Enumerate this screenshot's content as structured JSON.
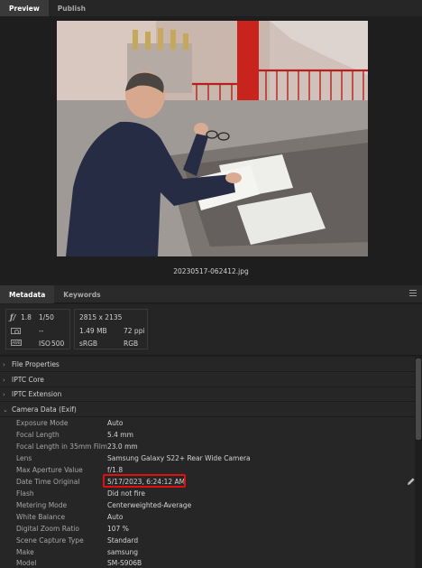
{
  "top_tabs": [
    "Preview",
    "Publish"
  ],
  "filename": "20230517-062412.jpg",
  "meta_tabs": [
    "Metadata",
    "Keywords"
  ],
  "summary": {
    "aperture": "1.8",
    "shutter": "1/50",
    "exposure_comp": "--",
    "iso_label": "ISO",
    "iso": "500",
    "wb_icon_text": "AWB",
    "dimensions": "2815 x 2135",
    "file_size": "1.49 MB",
    "resolution": "72 ppi",
    "color_space": "sRGB",
    "color_mode": "RGB"
  },
  "sections": {
    "file_properties": "File Properties",
    "iptc_core": "IPTC Core",
    "iptc_extension": "IPTC Extension",
    "camera_data": "Camera Data (Exif)"
  },
  "camera_rows": [
    {
      "label": "Exposure Mode",
      "value": "Auto"
    },
    {
      "label": "Focal Length",
      "value": "5.4 mm"
    },
    {
      "label": "Focal Length in 35mm Film",
      "value": "23.0 mm"
    },
    {
      "label": "Lens",
      "value": "Samsung Galaxy S22+ Rear Wide Camera"
    },
    {
      "label": "Max Aperture Value",
      "value": "f/1.8"
    },
    {
      "label": "Date Time Original",
      "value": "5/17/2023, 6:24:12 AM"
    },
    {
      "label": "Flash",
      "value": "Did not fire"
    },
    {
      "label": "Metering Mode",
      "value": "Centerweighted-Average"
    },
    {
      "label": "White Balance",
      "value": "Auto"
    },
    {
      "label": "Digital Zoom Ratio",
      "value": "107 %"
    },
    {
      "label": "Scene Capture Type",
      "value": "Standard"
    },
    {
      "label": "Make",
      "value": "samsung"
    },
    {
      "label": "Model",
      "value": "SM-S906B"
    }
  ],
  "highlight_color": "#e01010"
}
